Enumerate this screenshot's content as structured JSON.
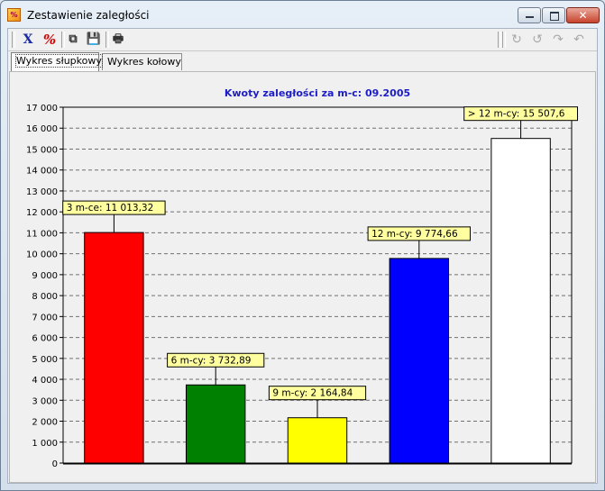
{
  "window": {
    "title": "Zestawienie zaległości",
    "controls": {
      "minimize": "minimize",
      "maximize": "maximize",
      "close": "✕"
    }
  },
  "toolbar": {
    "items": [
      {
        "name": "delete-icon",
        "glyph": "X",
        "enabled": true
      },
      {
        "name": "percent-icon",
        "glyph": "%",
        "enabled": true
      },
      {
        "name": "copy-icon",
        "glyph": "⧉",
        "enabled": true
      },
      {
        "name": "save-icon",
        "glyph": "💾",
        "enabled": true
      },
      {
        "name": "print-icon",
        "glyph": "🖶",
        "enabled": true
      }
    ],
    "right_items": [
      {
        "name": "rotate-cw-icon",
        "glyph": "↻",
        "enabled": false
      },
      {
        "name": "rotate-ccw-icon",
        "glyph": "↺",
        "enabled": false
      },
      {
        "name": "redo-icon",
        "glyph": "↷",
        "enabled": false
      },
      {
        "name": "undo-icon",
        "glyph": "↶",
        "enabled": false
      }
    ]
  },
  "tabs": [
    {
      "label": "Wykres słupkowy",
      "active": true
    },
    {
      "label": "Wykres kołowy",
      "active": false
    }
  ],
  "chart_data": {
    "type": "bar",
    "title": "Kwoty zaległości za m-c: 09.2005",
    "xlabel": "",
    "ylabel": "",
    "ylim": [
      0,
      17000
    ],
    "yticks": [
      "0",
      "1 000",
      "2 000",
      "3 000",
      "4 000",
      "5 000",
      "6 000",
      "7 000",
      "8 000",
      "9 000",
      "10 000",
      "11 000",
      "12 000",
      "13 000",
      "14 000",
      "15 000",
      "16 000",
      "17 000"
    ],
    "grid": true,
    "series": [
      {
        "category": "3 m-ce",
        "value": 11013.32,
        "label": "3 m-ce: 11 013,32",
        "color": "#ff0000"
      },
      {
        "category": "6 m-cy",
        "value": 3732.89,
        "label": "6 m-cy: 3 732,89",
        "color": "#008000"
      },
      {
        "category": "9 m-cy",
        "value": 2164.84,
        "label": "9 m-cy: 2 164,84",
        "color": "#ffff00"
      },
      {
        "category": "12 m-cy",
        "value": 9774.66,
        "label": "12 m-cy: 9 774,66",
        "color": "#0000ff"
      },
      {
        "category": "> 12 m-cy",
        "value": 15507.6,
        "label": "> 12 m-cy: 15 507,6",
        "color": "#ffffff"
      }
    ],
    "label_background": "#ffffa0"
  }
}
